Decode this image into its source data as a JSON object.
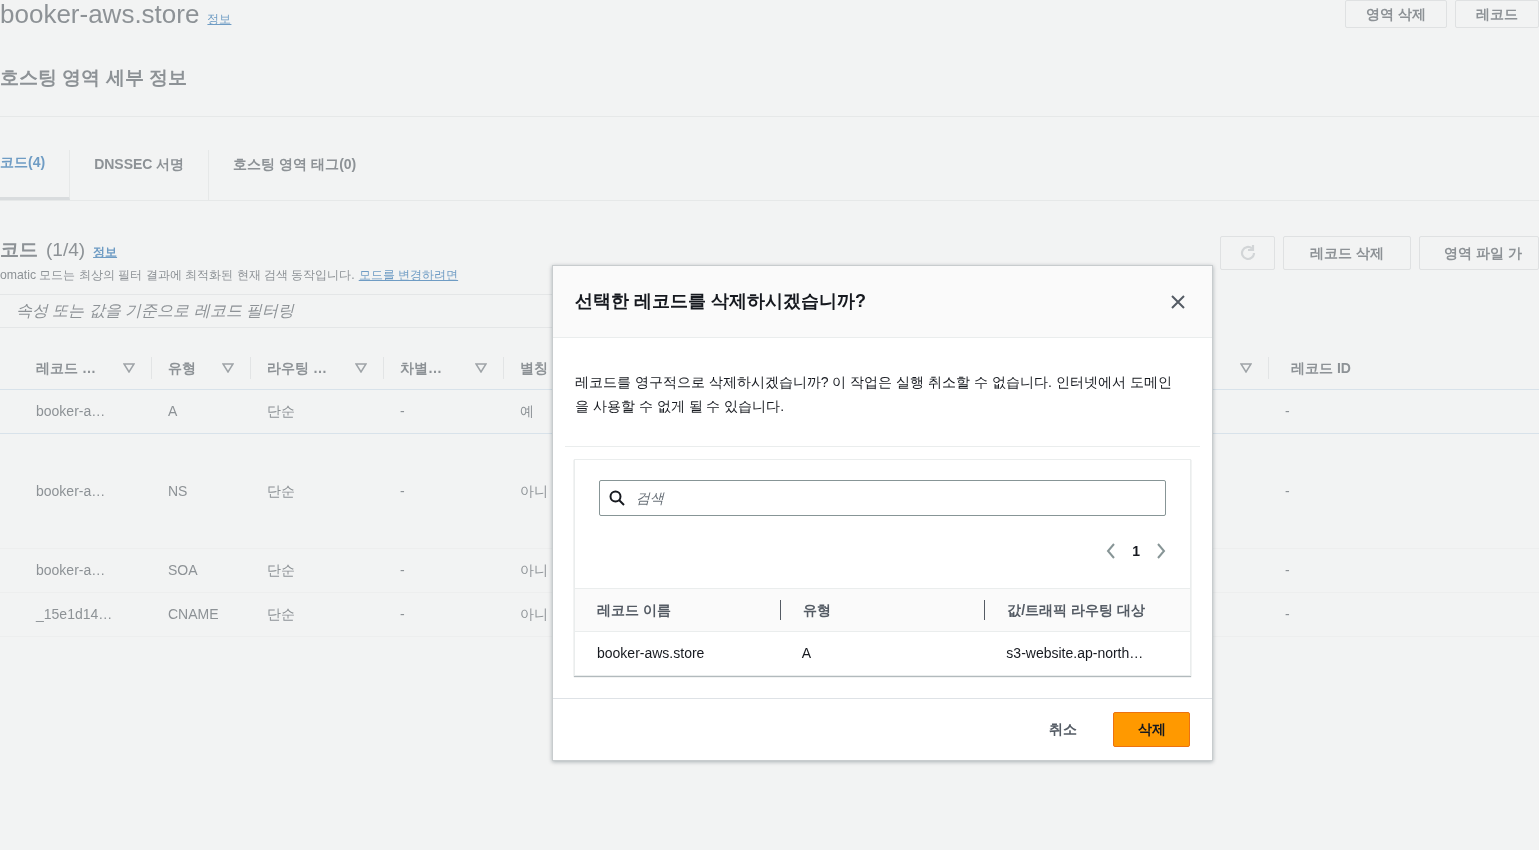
{
  "header": {
    "title": "booker-aws.store",
    "info_link": "정보",
    "buttons": [
      "영역 삭제",
      "레코드"
    ]
  },
  "section_title": "호스팅 영역 세부 정보",
  "tabs": [
    {
      "label": "코드(4)",
      "selected": true
    },
    {
      "label": "DNSSEC 서명",
      "selected": false
    },
    {
      "label": "호스팅 영역 태그(0)",
      "selected": false
    }
  ],
  "records": {
    "title": "코드",
    "count": "(1/4)",
    "info_link": "정보",
    "description": "omatic 모드는 최상의 필터 결과에 최적화된 현재 검색 동작입니다.",
    "description_link": "모드를 변경하려면",
    "buttons": [
      "레코드 삭제",
      "영역 파일 가"
    ],
    "filter": {
      "placeholder": "속성 또는 값을 기준으로 레코드 필터링"
    },
    "columns": [
      "레코드 …",
      "유형",
      "라우팅 …",
      "차별…",
      "별칭"
    ],
    "last_column": "레코드 ID",
    "rows": [
      {
        "cells": [
          "booker-a…",
          "A",
          "단순",
          "-",
          "예"
        ],
        "record_id": "-",
        "selected": true,
        "kind": "short"
      },
      {
        "cells": [
          "booker-a…",
          "NS",
          "단순",
          "-",
          "아니"
        ],
        "record_id": "-",
        "selected": false,
        "kind": "tall"
      },
      {
        "cells": [
          "booker-a…",
          "SOA",
          "단순",
          "-",
          "아니"
        ],
        "record_id": "-",
        "selected": false,
        "kind": "short"
      },
      {
        "cells": [
          "_15e1d14…",
          "CNAME",
          "단순",
          "-",
          "아니"
        ],
        "record_id": "-",
        "selected": false,
        "kind": "short"
      }
    ]
  },
  "dialog": {
    "title": "선택한 레코드를 삭제하시겠습니까?",
    "message": "레코드를 영구적으로 삭제하시겠습니까? 이 작업은 실행 취소할 수 없습니다. 인터넷에서 도메인을 사용할 수 없게 될 수 있습니다.",
    "search": {
      "placeholder": "검색"
    },
    "page": "1",
    "columns": [
      "레코드 이름",
      "유형",
      "값/트래픽 라우팅 대상"
    ],
    "rows": [
      [
        "booker-aws.store",
        "A",
        "s3-website.ap-north…"
      ]
    ],
    "buttons": [
      {
        "label": "취소",
        "kind": "link"
      },
      {
        "label": "삭제",
        "kind": "primary"
      }
    ]
  }
}
